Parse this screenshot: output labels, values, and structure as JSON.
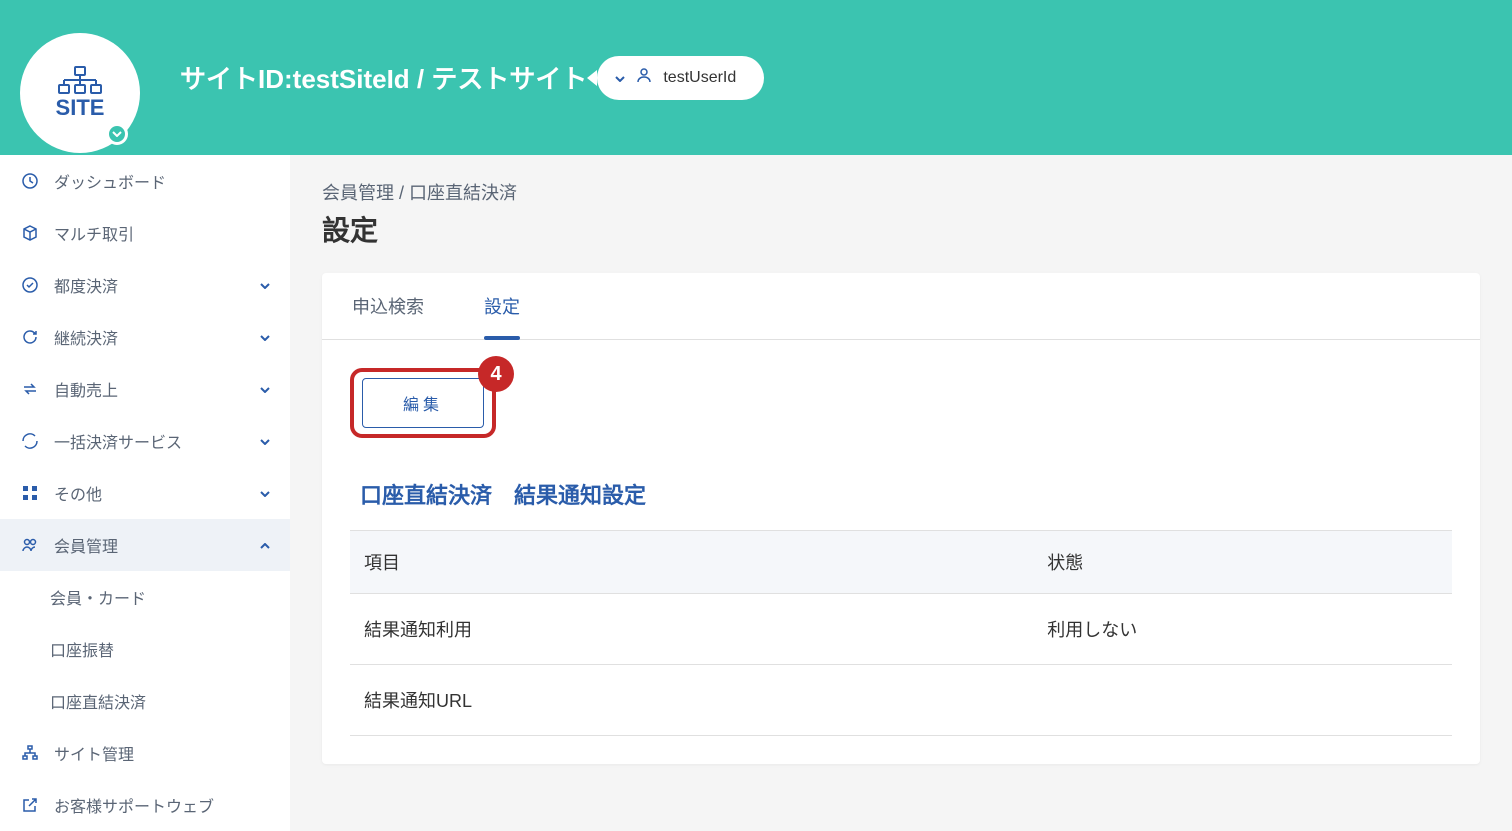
{
  "header": {
    "site_badge_text": "SITE",
    "title": "サイトID:testSiteId / テストサイト",
    "user_id": "testUserId"
  },
  "sidebar": {
    "items": [
      {
        "label": "ダッシュボード",
        "icon": "clock-icon",
        "expandable": false
      },
      {
        "label": "マルチ取引",
        "icon": "cube-icon",
        "expandable": false
      },
      {
        "label": "都度決済",
        "icon": "check-circle-icon",
        "expandable": true,
        "open": false
      },
      {
        "label": "継続決済",
        "icon": "refresh-icon",
        "expandable": true,
        "open": false
      },
      {
        "label": "自動売上",
        "icon": "exchange-icon",
        "expandable": true,
        "open": false
      },
      {
        "label": "一括決済サービス",
        "icon": "loop-icon",
        "expandable": true,
        "open": false
      },
      {
        "label": "その他",
        "icon": "grid-icon",
        "expandable": true,
        "open": false
      },
      {
        "label": "会員管理",
        "icon": "users-icon",
        "expandable": true,
        "open": true,
        "active": true,
        "subitems": [
          {
            "label": "会員・カード"
          },
          {
            "label": "口座振替"
          },
          {
            "label": "口座直結決済"
          }
        ]
      },
      {
        "label": "サイト管理",
        "icon": "sitemap-icon",
        "expandable": false
      },
      {
        "label": "お客様サポートウェブ",
        "icon": "external-link-icon",
        "expandable": false
      }
    ]
  },
  "main": {
    "breadcrumb": "会員管理 / 口座直結決済",
    "page_title": "設定",
    "tabs": [
      {
        "label": "申込検索",
        "active": false
      },
      {
        "label": "設定",
        "active": true
      }
    ],
    "edit_button_label": "編集",
    "annotation_number": "4",
    "section_title": "口座直結決済　結果通知設定",
    "table": {
      "headers": {
        "item": "項目",
        "state": "状態"
      },
      "rows": [
        {
          "item": "結果通知利用",
          "state": "利用しない"
        },
        {
          "item": "結果通知URL",
          "state": ""
        }
      ]
    }
  }
}
